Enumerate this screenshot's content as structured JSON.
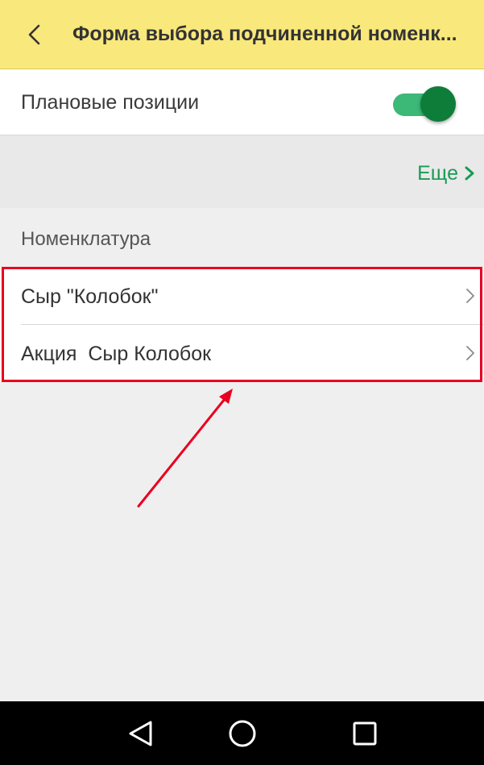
{
  "header": {
    "title": "Форма выбора подчиненной номенк...",
    "back_icon": "chevron-left-icon"
  },
  "plan_row": {
    "label": "Плановые позиции",
    "toggle_on": true,
    "toggle_color": "#0e7d3a"
  },
  "more": {
    "label": "Еще",
    "icon": "chevron-right-icon"
  },
  "section": {
    "title": "Номенклатура"
  },
  "items": [
    {
      "label": "Сыр \"Колобок\"",
      "icon": "chevron-right-icon"
    },
    {
      "label": "Акция  Сыр Колобок",
      "icon": "chevron-right-icon"
    }
  ],
  "annotation": {
    "color": "#e8001f"
  },
  "navbar": {
    "buttons": [
      "back-triangle-icon",
      "home-circle-icon",
      "recents-square-icon"
    ]
  },
  "colors": {
    "header_bg": "#f9e87c",
    "accent_green": "#1a9a55",
    "toggle_track": "#3cb877"
  }
}
